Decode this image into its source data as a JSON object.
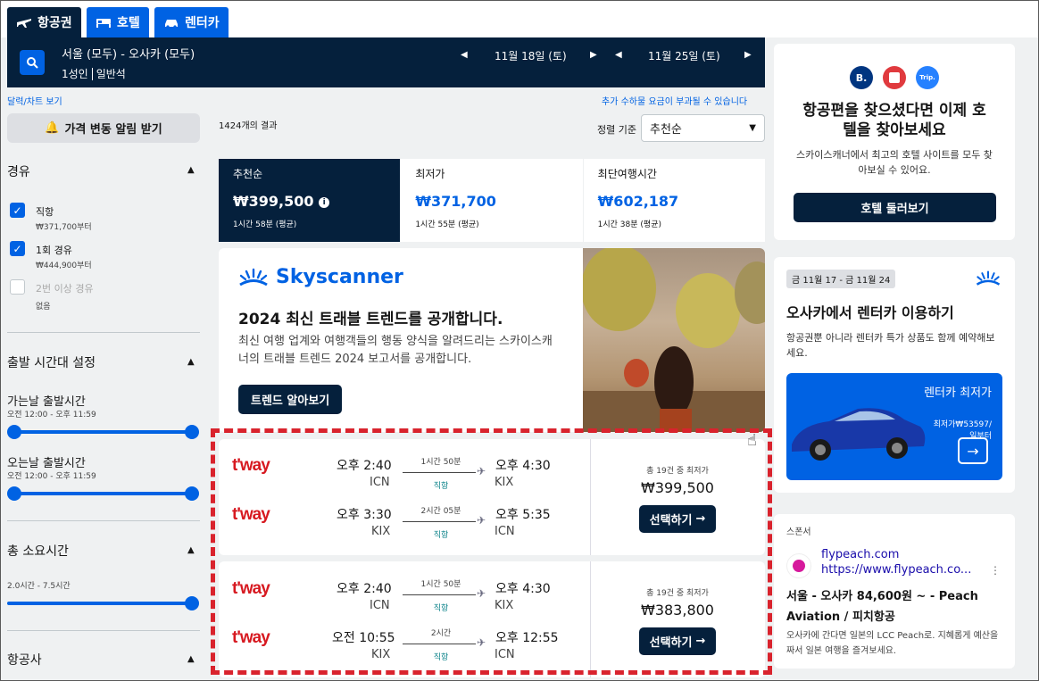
{
  "tabs": [
    {
      "label": "항공권"
    },
    {
      "label": "호텔"
    },
    {
      "label": "렌터카"
    }
  ],
  "search": {
    "route": "서울 (모두) - 오사카 (모두)",
    "passengers": "1성인",
    "cabin": "일반석",
    "depart_date": "11월 18일 (토)",
    "return_date": "11월 25일 (토)"
  },
  "links": {
    "calendar": "달력/차트 보기",
    "fees": "추가 수하물 요금이 부과될 수 있습니다"
  },
  "sidebar": {
    "price_alert": "가격 변동 알림 받기",
    "stops_title": "경유",
    "stops": [
      {
        "label": "직항",
        "sub": "₩371,700부터"
      },
      {
        "label": "1회 경유",
        "sub": "₩444,900부터"
      },
      {
        "label": "2번 이상 경유",
        "sub": "없음"
      }
    ],
    "time_title": "출발 시간대 설정",
    "outbound_label": "가는날 출발시간",
    "outbound_range": "오전 12:00 - 오후 11:59",
    "inbound_label": "오는날 출발시간",
    "inbound_range": "오전 12:00 - 오후 11:59",
    "duration_title": "총 소요시간",
    "duration_range": "2.0시간 - 7.5시간",
    "airline_title": "항공사"
  },
  "results": {
    "count": "1424개의 결과",
    "sort_label": "정렬 기준",
    "sort_value": "추천순"
  },
  "sort_tabs": [
    {
      "label": "추천순",
      "price": "₩399,500",
      "duration": "1시간 58분 (평균)"
    },
    {
      "label": "최저가",
      "price": "₩371,700",
      "duration": "1시간 55분 (평균)"
    },
    {
      "label": "최단여행시간",
      "price": "₩602,187",
      "duration": "1시간 38분 (평균)"
    }
  ],
  "ad": {
    "brand": "Skyscanner",
    "title": "2024 최신 트래블 트렌드를 공개합니다.",
    "body": "최신 여행 업계와 여행객들의 행동 양식을 알려드리는 스카이스캐너의 트래블 트렌드 2024 보고서를 공개합니다.",
    "button": "트렌드 알아보기"
  },
  "flights": [
    {
      "legs": [
        {
          "airline": "t'way",
          "dep_time": "오후 2:40",
          "dep_ap": "ICN",
          "duration": "1시간 50분",
          "type": "직항",
          "arr_time": "오후 4:30",
          "arr_ap": "KIX"
        },
        {
          "airline": "t'way",
          "dep_time": "오후 3:30",
          "dep_ap": "KIX",
          "duration": "2시간 05분",
          "type": "직항",
          "arr_time": "오후 5:35",
          "arr_ap": "ICN"
        }
      ],
      "count": "총 19건 중 최저가",
      "price": "₩399,500",
      "button": "선택하기"
    },
    {
      "legs": [
        {
          "airline": "t'way",
          "dep_time": "오후 2:40",
          "dep_ap": "ICN",
          "duration": "1시간 50분",
          "type": "직항",
          "arr_time": "오후 4:30",
          "arr_ap": "KIX"
        },
        {
          "airline": "t'way",
          "dep_time": "오전 10:55",
          "dep_ap": "KIX",
          "duration": "2시간",
          "type": "직항",
          "arr_time": "오후 12:55",
          "arr_ap": "ICN"
        }
      ],
      "count": "총 19건 중 최저가",
      "price": "₩383,800",
      "button": "선택하기"
    }
  ],
  "hotel_ad": {
    "badges": [
      "B.",
      "Trip."
    ],
    "title": "항공편을 찾으셨다면 이제 호텔을 찾아보세요",
    "body": "스카이스캐너에서 최고의 호텔 사이트를 모두 찾아보실 수 있어요.",
    "button": "호텔 둘러보기"
  },
  "car_ad": {
    "dates": "금 11월 17 - 금 11월 24",
    "title": "오사카에서 렌터카 이용하기",
    "body": "항공권뿐 아니라 렌터카 특가 상품도 함께 예약해보세요.",
    "promo_title": "렌터카 최저가",
    "promo_price": "최저가₩53597/",
    "promo_unit": "일부터"
  },
  "sponsor": {
    "label": "스폰서",
    "name": "flypeach.com",
    "url": "https://www.flypeach.co...",
    "title": "서울 - 오사카 84,600원 ~ - Peach Aviation / 피치항공",
    "body": "오사카에 간다면 일본의 LCC Peach로. 지혜롭게 예산을 짜서 일본 여행을 즐겨보세요."
  },
  "colors": {
    "navy": "#05203c",
    "blue": "#0062e3",
    "red_dash": "#d9232d",
    "tway_red": "#d71920"
  }
}
